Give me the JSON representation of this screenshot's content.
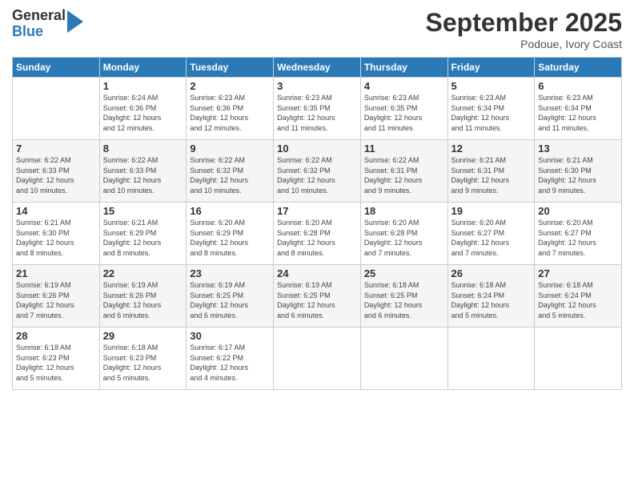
{
  "logo": {
    "general": "General",
    "blue": "Blue"
  },
  "header": {
    "month": "September 2025",
    "location": "Podoue, Ivory Coast"
  },
  "days_of_week": [
    "Sunday",
    "Monday",
    "Tuesday",
    "Wednesday",
    "Thursday",
    "Friday",
    "Saturday"
  ],
  "weeks": [
    [
      {
        "day": "",
        "info": ""
      },
      {
        "day": "1",
        "info": "Sunrise: 6:24 AM\nSunset: 6:36 PM\nDaylight: 12 hours\nand 12 minutes."
      },
      {
        "day": "2",
        "info": "Sunrise: 6:23 AM\nSunset: 6:36 PM\nDaylight: 12 hours\nand 12 minutes."
      },
      {
        "day": "3",
        "info": "Sunrise: 6:23 AM\nSunset: 6:35 PM\nDaylight: 12 hours\nand 11 minutes."
      },
      {
        "day": "4",
        "info": "Sunrise: 6:23 AM\nSunset: 6:35 PM\nDaylight: 12 hours\nand 11 minutes."
      },
      {
        "day": "5",
        "info": "Sunrise: 6:23 AM\nSunset: 6:34 PM\nDaylight: 12 hours\nand 11 minutes."
      },
      {
        "day": "6",
        "info": "Sunrise: 6:23 AM\nSunset: 6:34 PM\nDaylight: 12 hours\nand 11 minutes."
      }
    ],
    [
      {
        "day": "7",
        "info": "Sunrise: 6:22 AM\nSunset: 6:33 PM\nDaylight: 12 hours\nand 10 minutes."
      },
      {
        "day": "8",
        "info": "Sunrise: 6:22 AM\nSunset: 6:33 PM\nDaylight: 12 hours\nand 10 minutes."
      },
      {
        "day": "9",
        "info": "Sunrise: 6:22 AM\nSunset: 6:32 PM\nDaylight: 12 hours\nand 10 minutes."
      },
      {
        "day": "10",
        "info": "Sunrise: 6:22 AM\nSunset: 6:32 PM\nDaylight: 12 hours\nand 10 minutes."
      },
      {
        "day": "11",
        "info": "Sunrise: 6:22 AM\nSunset: 6:31 PM\nDaylight: 12 hours\nand 9 minutes."
      },
      {
        "day": "12",
        "info": "Sunrise: 6:21 AM\nSunset: 6:31 PM\nDaylight: 12 hours\nand 9 minutes."
      },
      {
        "day": "13",
        "info": "Sunrise: 6:21 AM\nSunset: 6:30 PM\nDaylight: 12 hours\nand 9 minutes."
      }
    ],
    [
      {
        "day": "14",
        "info": "Sunrise: 6:21 AM\nSunset: 6:30 PM\nDaylight: 12 hours\nand 8 minutes."
      },
      {
        "day": "15",
        "info": "Sunrise: 6:21 AM\nSunset: 6:29 PM\nDaylight: 12 hours\nand 8 minutes."
      },
      {
        "day": "16",
        "info": "Sunrise: 6:20 AM\nSunset: 6:29 PM\nDaylight: 12 hours\nand 8 minutes."
      },
      {
        "day": "17",
        "info": "Sunrise: 6:20 AM\nSunset: 6:28 PM\nDaylight: 12 hours\nand 8 minutes."
      },
      {
        "day": "18",
        "info": "Sunrise: 6:20 AM\nSunset: 6:28 PM\nDaylight: 12 hours\nand 7 minutes."
      },
      {
        "day": "19",
        "info": "Sunrise: 6:20 AM\nSunset: 6:27 PM\nDaylight: 12 hours\nand 7 minutes."
      },
      {
        "day": "20",
        "info": "Sunrise: 6:20 AM\nSunset: 6:27 PM\nDaylight: 12 hours\nand 7 minutes."
      }
    ],
    [
      {
        "day": "21",
        "info": "Sunrise: 6:19 AM\nSunset: 6:26 PM\nDaylight: 12 hours\nand 7 minutes."
      },
      {
        "day": "22",
        "info": "Sunrise: 6:19 AM\nSunset: 6:26 PM\nDaylight: 12 hours\nand 6 minutes."
      },
      {
        "day": "23",
        "info": "Sunrise: 6:19 AM\nSunset: 6:25 PM\nDaylight: 12 hours\nand 6 minutes."
      },
      {
        "day": "24",
        "info": "Sunrise: 6:19 AM\nSunset: 6:25 PM\nDaylight: 12 hours\nand 6 minutes."
      },
      {
        "day": "25",
        "info": "Sunrise: 6:18 AM\nSunset: 6:25 PM\nDaylight: 12 hours\nand 6 minutes."
      },
      {
        "day": "26",
        "info": "Sunrise: 6:18 AM\nSunset: 6:24 PM\nDaylight: 12 hours\nand 5 minutes."
      },
      {
        "day": "27",
        "info": "Sunrise: 6:18 AM\nSunset: 6:24 PM\nDaylight: 12 hours\nand 5 minutes."
      }
    ],
    [
      {
        "day": "28",
        "info": "Sunrise: 6:18 AM\nSunset: 6:23 PM\nDaylight: 12 hours\nand 5 minutes."
      },
      {
        "day": "29",
        "info": "Sunrise: 6:18 AM\nSunset: 6:23 PM\nDaylight: 12 hours\nand 5 minutes."
      },
      {
        "day": "30",
        "info": "Sunrise: 6:17 AM\nSunset: 6:22 PM\nDaylight: 12 hours\nand 4 minutes."
      },
      {
        "day": "",
        "info": ""
      },
      {
        "day": "",
        "info": ""
      },
      {
        "day": "",
        "info": ""
      },
      {
        "day": "",
        "info": ""
      }
    ]
  ]
}
